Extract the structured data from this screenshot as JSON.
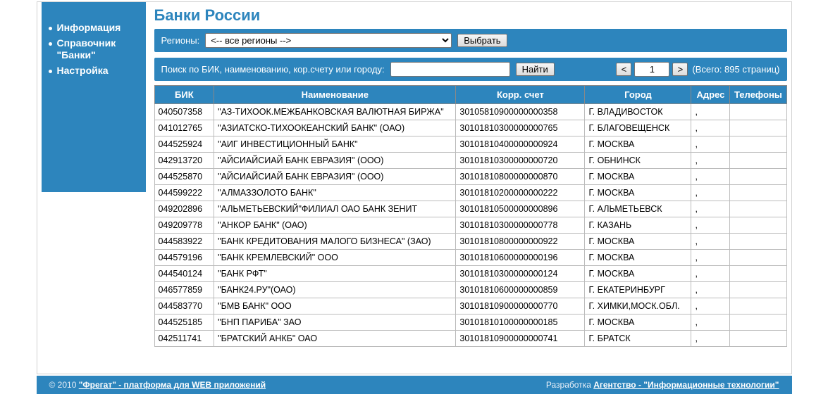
{
  "sidebar": {
    "items": [
      {
        "label": "Информация"
      },
      {
        "label": "Справочник \"Банки\""
      },
      {
        "label": "Настройка"
      }
    ]
  },
  "page": {
    "title": "Банки России"
  },
  "regions": {
    "label": "Регионы:",
    "selected": "<-- все регионы -->",
    "button": "Выбрать"
  },
  "search": {
    "label": "Поиск по БИК, наименованию, кор.счету или городу:",
    "value": "",
    "button": "Найти"
  },
  "pager": {
    "prev": "<",
    "next": ">",
    "page": "1",
    "total_label": "(Всего: 895 страниц)"
  },
  "table": {
    "headers": [
      "БИК",
      "Наименование",
      "Корр. счет",
      "Город",
      "Адрес",
      "Телефоны"
    ],
    "rows": [
      {
        "bik": "040507358",
        "name": "\"АЗ-ТИХООК.МЕЖБАНКОВСКАЯ ВАЛЮТНАЯ БИРЖА\"",
        "corr": "30105810900000000358",
        "city": "Г. ВЛАДИВОСТОК",
        "addr": ",",
        "tel": ""
      },
      {
        "bik": "041012765",
        "name": "\"АЗИАТСКО-ТИХООКЕАНСКИЙ БАНК\" (ОАО)",
        "corr": "30101810300000000765",
        "city": "Г. БЛАГОВЕЩЕНСК",
        "addr": ",",
        "tel": ""
      },
      {
        "bik": "044525924",
        "name": "\"АИГ ИНВЕСТИЦИОННЫЙ БАНК\"",
        "corr": "30101810400000000924",
        "city": "Г. МОСКВА",
        "addr": ",",
        "tel": ""
      },
      {
        "bik": "042913720",
        "name": "\"АЙСИАЙСИАЙ БАНК ЕВРАЗИЯ\" (ООО)",
        "corr": "30101810300000000720",
        "city": "Г. ОБНИНСК",
        "addr": ",",
        "tel": ""
      },
      {
        "bik": "044525870",
        "name": "\"АЙСИАЙСИАЙ БАНК ЕВРАЗИЯ\" (ООО)",
        "corr": "30101810800000000870",
        "city": "Г. МОСКВА",
        "addr": ",",
        "tel": ""
      },
      {
        "bik": "044599222",
        "name": "\"АЛМАЗЗОЛОТО БАНК\"",
        "corr": "30101810200000000222",
        "city": "Г. МОСКВА",
        "addr": ",",
        "tel": ""
      },
      {
        "bik": "049202896",
        "name": "\"АЛЬМЕТЬЕВСКИЙ\"ФИЛИАЛ ОАО БАНК ЗЕНИТ",
        "corr": "30101810500000000896",
        "city": "Г. АЛЬМЕТЬЕВСК",
        "addr": ",",
        "tel": ""
      },
      {
        "bik": "049209778",
        "name": "\"АНКОР БАНК\" (ОАО)",
        "corr": "30101810300000000778",
        "city": "Г. КАЗАНЬ",
        "addr": ",",
        "tel": ""
      },
      {
        "bik": "044583922",
        "name": "\"БАНК КРЕДИТОВАНИЯ МАЛОГО БИЗНЕСА\" (ЗАО)",
        "corr": "30101810800000000922",
        "city": "Г. МОСКВА",
        "addr": ",",
        "tel": ""
      },
      {
        "bik": "044579196",
        "name": "\"БАНК КРЕМЛЕВСКИЙ\" ООО",
        "corr": "30101810600000000196",
        "city": "Г. МОСКВА",
        "addr": ",",
        "tel": ""
      },
      {
        "bik": "044540124",
        "name": "\"БАНК РФТ\"",
        "corr": "30101810300000000124",
        "city": "Г. МОСКВА",
        "addr": ",",
        "tel": ""
      },
      {
        "bik": "046577859",
        "name": "\"БАНК24.РУ\"(ОАО)",
        "corr": "30101810600000000859",
        "city": "Г. ЕКАТЕРИНБУРГ",
        "addr": ",",
        "tel": ""
      },
      {
        "bik": "044583770",
        "name": "\"БМВ БАНК\" ООО",
        "corr": "30101810900000000770",
        "city": "Г. ХИМКИ,МОСК.ОБЛ.",
        "addr": ",",
        "tel": ""
      },
      {
        "bik": "044525185",
        "name": "\"БНП ПАРИБА\" ЗАО",
        "corr": "30101810100000000185",
        "city": "Г. МОСКВА",
        "addr": ",",
        "tel": ""
      },
      {
        "bik": "042511741",
        "name": "\"БРАТСКИЙ АНКБ\" ОАО",
        "corr": "30101810900000000741",
        "city": "Г. БРАТСК",
        "addr": ",",
        "tel": ""
      }
    ]
  },
  "footer": {
    "left_prefix": "© 2010 ",
    "left_link": "\"Фрегат\" - платформа для WEB приложений",
    "right_prefix": "Разработка ",
    "right_link": "Агентство - \"Информационные технологии\""
  }
}
